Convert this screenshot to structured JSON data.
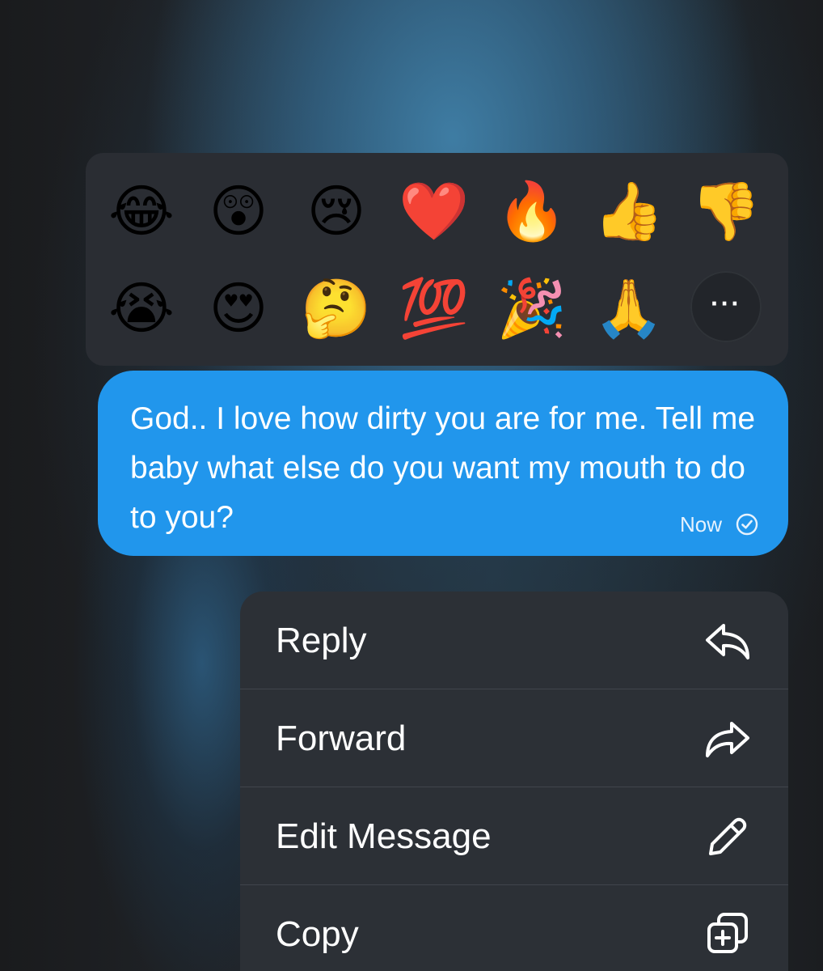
{
  "reactions": {
    "row1": [
      "😂",
      "😲",
      "😢",
      "❤️",
      "🔥",
      "👍",
      "👎"
    ],
    "row2": [
      "😭",
      "😍",
      "🤔",
      "💯",
      "🎉",
      "🙏"
    ],
    "more_label": "···"
  },
  "message": {
    "text": "God.. I love how dirty you are for me. Tell me baby what else do you want my mouth to do to you?",
    "time": "Now",
    "status_icon": "check-circle-icon",
    "bubble_color": "#2196ec"
  },
  "menu": {
    "items": [
      {
        "label": "Reply",
        "icon": "reply-icon"
      },
      {
        "label": "Forward",
        "icon": "forward-icon"
      },
      {
        "label": "Edit Message",
        "icon": "pencil-icon"
      },
      {
        "label": "Copy",
        "icon": "copy-icon"
      }
    ]
  },
  "colors": {
    "panel_background": "#2a2d33",
    "menu_background": "#2c3036",
    "text": "#ffffff"
  }
}
